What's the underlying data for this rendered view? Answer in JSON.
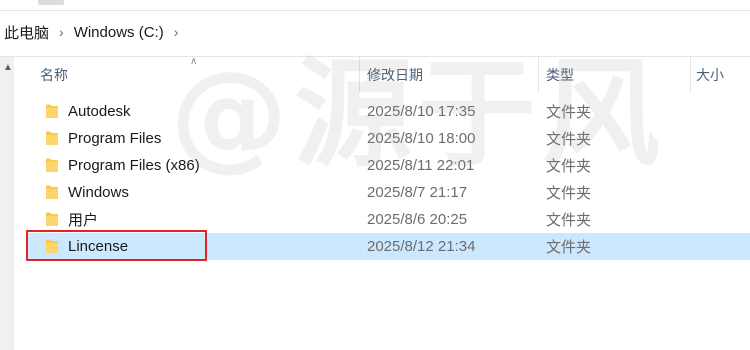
{
  "breadcrumb": {
    "items": [
      "此电脑",
      "Windows (C:)"
    ],
    "separator_icon": "chevron-right-icon"
  },
  "columns": {
    "name": "名称",
    "date": "修改日期",
    "type": "类型",
    "size": "大小"
  },
  "rows": [
    {
      "name": "Autodesk",
      "date": "2025/8/10 17:35",
      "type": "文件夹",
      "selected": false
    },
    {
      "name": "Program Files",
      "date": "2025/8/10 18:00",
      "type": "文件夹",
      "selected": false
    },
    {
      "name": "Program Files (x86)",
      "date": "2025/8/11 22:01",
      "type": "文件夹",
      "selected": false
    },
    {
      "name": "Windows",
      "date": "2025/8/7 21:17",
      "type": "文件夹",
      "selected": false
    },
    {
      "name": "用户",
      "date": "2025/8/6 20:25",
      "type": "文件夹",
      "selected": false
    },
    {
      "name": "Lincense",
      "date": "2025/8/12 21:34",
      "type": "文件夹",
      "selected": true
    }
  ],
  "watermark": "@源于风",
  "colors": {
    "selection": "#cce8ff",
    "highlight_border": "#e02424",
    "folder": "#f8c94b",
    "header_text": "#4c607a"
  }
}
